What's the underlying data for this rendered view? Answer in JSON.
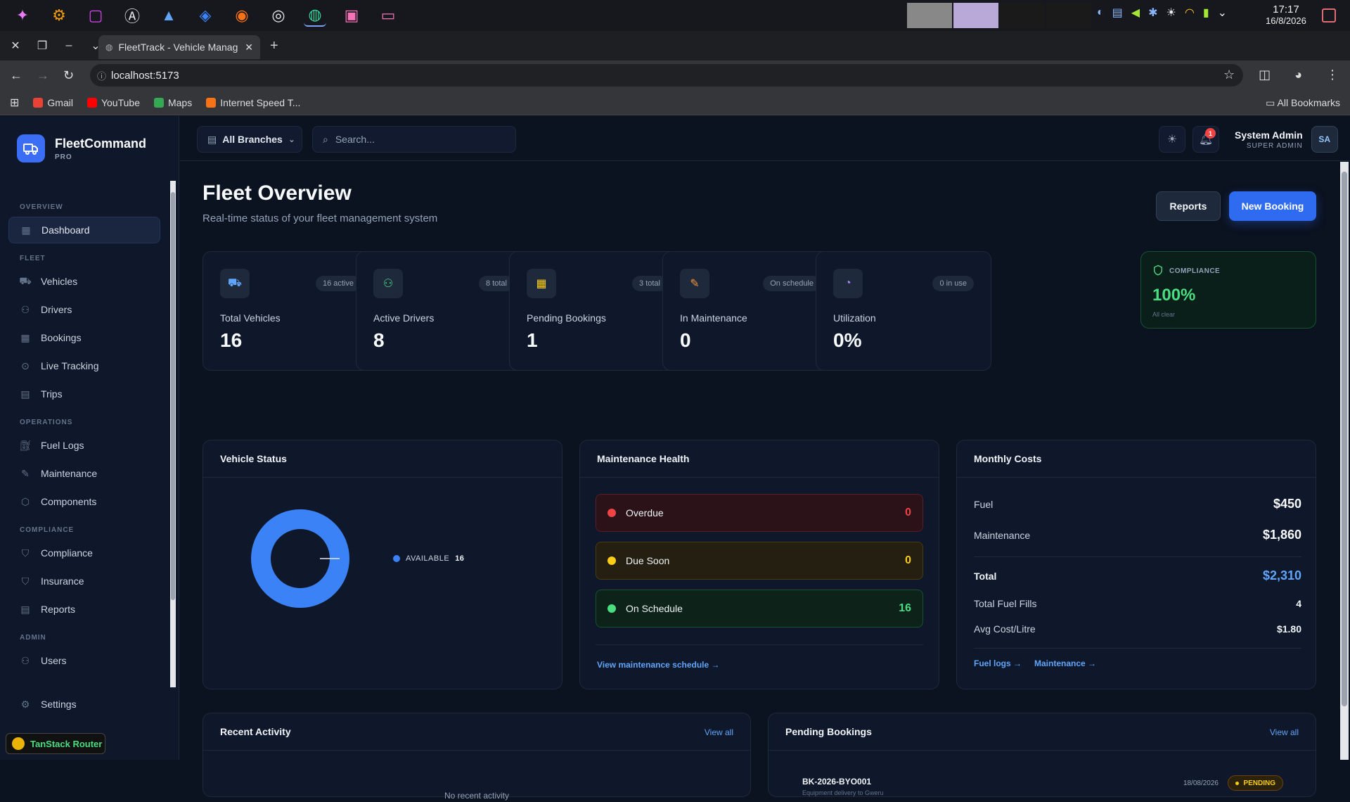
{
  "os": {
    "clock_time": "17:17",
    "clock_date": "16/8/2026"
  },
  "browser": {
    "tab_title": "FleetTrack - Vehicle Manag",
    "url": "localhost:5173",
    "bookmarks": [
      {
        "label": "Gmail",
        "icon": "gmail-icon",
        "color": "#ea4335"
      },
      {
        "label": "YouTube",
        "icon": "youtube-icon",
        "color": "#ff0000"
      },
      {
        "label": "Maps",
        "icon": "maps-icon",
        "color": "#34a853"
      },
      {
        "label": "Internet Speed T...",
        "icon": "speed-icon",
        "color": "#f97316"
      }
    ],
    "all_bookmarks": "All Bookmarks"
  },
  "sidebar": {
    "brand_name": "FleetCommand",
    "brand_sub": "PRO",
    "sections": [
      {
        "title": "OVERVIEW",
        "items": [
          {
            "label": "Dashboard",
            "icon": "dashboard-icon",
            "active": true
          }
        ]
      },
      {
        "title": "FLEET",
        "items": [
          {
            "label": "Vehicles",
            "icon": "truck-icon"
          },
          {
            "label": "Drivers",
            "icon": "users-icon"
          },
          {
            "label": "Bookings",
            "icon": "calendar-icon"
          },
          {
            "label": "Live Tracking",
            "icon": "map-pin-icon"
          },
          {
            "label": "Trips",
            "icon": "clipboard-icon"
          }
        ]
      },
      {
        "title": "OPERATIONS",
        "items": [
          {
            "label": "Fuel Logs",
            "icon": "fuel-icon"
          },
          {
            "label": "Maintenance",
            "icon": "wrench-icon"
          },
          {
            "label": "Components",
            "icon": "package-icon"
          }
        ]
      },
      {
        "title": "COMPLIANCE",
        "items": [
          {
            "label": "Compliance",
            "icon": "shield-icon"
          },
          {
            "label": "Insurance",
            "icon": "shield-check-icon"
          },
          {
            "label": "Reports",
            "icon": "file-icon"
          }
        ]
      },
      {
        "title": "ADMIN",
        "items": [
          {
            "label": "Users",
            "icon": "user-icon"
          }
        ]
      }
    ],
    "settings_label": "Settings",
    "devtools_label": "TanStack Router"
  },
  "topbar": {
    "branch_label": "All Branches",
    "search_placeholder": "Search...",
    "notification_count": "1",
    "user_name": "System Admin",
    "user_role": "SUPER ADMIN",
    "user_initials": "SA"
  },
  "page": {
    "title": "Fleet Overview",
    "subtitle": "Real-time status of your fleet management system",
    "reports_button": "Reports",
    "new_booking_button": "New Booking"
  },
  "stats": [
    {
      "label": "Total Vehicles",
      "value": "16",
      "badge": "16 active",
      "icon": "truck-icon",
      "color": "#60a5fa"
    },
    {
      "label": "Active Drivers",
      "value": "8",
      "badge": "8 total",
      "icon": "users-icon",
      "color": "#4ade80"
    },
    {
      "label": "Pending Bookings",
      "value": "1",
      "badge": "3 total",
      "icon": "calendar-icon",
      "color": "#facc15"
    },
    {
      "label": "In Maintenance",
      "value": "0",
      "badge": "On schedule",
      "icon": "wrench-icon",
      "color": "#fb923c"
    },
    {
      "label": "Utilization",
      "value": "0%",
      "badge": "0 in use",
      "icon": "gauge-icon",
      "color": "#a78bfa"
    }
  ],
  "compliance": {
    "label": "COMPLIANCE",
    "value": "100%",
    "sub": "All clear"
  },
  "vehicle_status": {
    "title": "Vehicle Status",
    "legend_label": "AVAILABLE",
    "legend_value": "16",
    "available_fraction": 1.0,
    "color": "#3b82f6"
  },
  "maintenance_health": {
    "title": "Maintenance Health",
    "rows": [
      {
        "label": "Overdue",
        "value": "0",
        "color": "#ef4444",
        "bg": "#2a1218",
        "border": "#5b1d26"
      },
      {
        "label": "Due Soon",
        "value": "0",
        "color": "#facc15",
        "bg": "#241f10",
        "border": "#4a3a12"
      },
      {
        "label": "On Schedule",
        "value": "16",
        "color": "#4ade80",
        "bg": "#0d2219",
        "border": "#14532d"
      }
    ],
    "link": "View maintenance schedule →"
  },
  "monthly_costs": {
    "title": "Monthly Costs",
    "fuel_label": "Fuel",
    "fuel_value": "$450",
    "maint_label": "Maintenance",
    "maint_value": "$1,860",
    "total_label": "Total",
    "total_value": "$2,310",
    "fills_label": "Total Fuel Fills",
    "fills_value": "4",
    "avg_label": "Avg Cost/Litre",
    "avg_value": "$1.80",
    "link_fuel": "Fuel logs →",
    "link_maint": "Maintenance →"
  },
  "recent_activity": {
    "title": "Recent Activity",
    "view_all": "View all",
    "empty": "No recent activity"
  },
  "pending_bookings": {
    "title": "Pending Bookings",
    "view_all": "View all",
    "items": [
      {
        "id": "BK-2026-BYO001",
        "desc": "Equipment delivery to Gweru",
        "date": "18/08/2026",
        "status": "PENDING"
      }
    ]
  }
}
